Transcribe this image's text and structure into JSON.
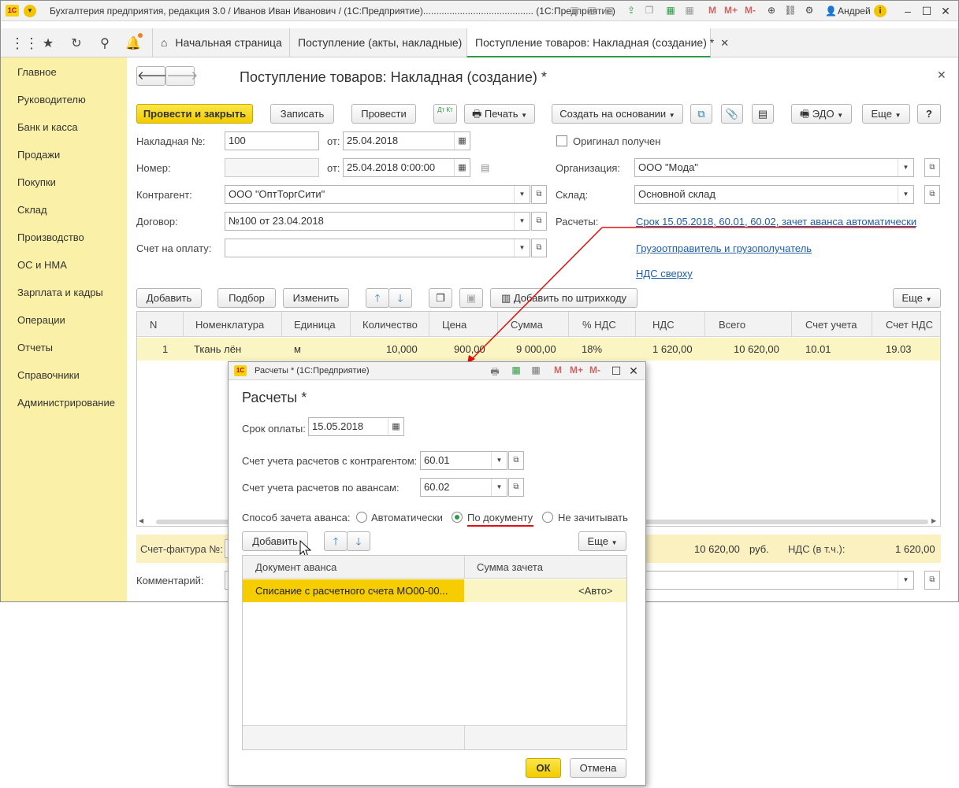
{
  "window": {
    "title": "Бухгалтерия предприятия, редакция 3.0 / Иванов Иван Иванович / (1С:Предприятие).......................................... (1С:Предприятие)",
    "user": "Андрей"
  },
  "tabs": [
    {
      "label": "Начальная страница"
    },
    {
      "label": "Поступление (акты, накладные)"
    },
    {
      "label": "Поступление товаров: Накладная (создание) *"
    }
  ],
  "sidebar": {
    "items": [
      "Главное",
      "Руководителю",
      "Банк и касса",
      "Продажи",
      "Покупки",
      "Склад",
      "Производство",
      "ОС и НМА",
      "Зарплата и кадры",
      "Операции",
      "Отчеты",
      "Справочники",
      "Администрирование"
    ]
  },
  "doc": {
    "title": "Поступление товаров: Накладная (создание) *",
    "toolbar": {
      "post_close": "Провести и закрыть",
      "save": "Записать",
      "post": "Провести",
      "dtkt": "Дт Кт",
      "print": "Печать",
      "create_based": "Создать на основании",
      "edo": "ЭДО",
      "more": "Еще",
      "help": "?"
    },
    "invoice_no_label": "Накладная №:",
    "invoice_no": "100",
    "from_label": "от:",
    "date1": "25.04.2018",
    "original_label": "Оригинал получен",
    "number_label": "Номер:",
    "number": "",
    "date2": "25.04.2018  0:00:00",
    "org_label": "Организация:",
    "org": "ООО \"Мода\"",
    "counterparty_label": "Контрагент:",
    "counterparty": "ООО \"ОптТоргСити\"",
    "warehouse_label": "Склад:",
    "warehouse": "Основной склад",
    "contract_label": "Договор:",
    "contract": "№100 от 23.04.2018",
    "settlements_label": "Расчеты:",
    "settlements_link": "Срок 15.05.2018, 60.01, 60.02, зачет аванса автоматически",
    "payment_invoice_label": "Счет на оплату:",
    "payment_invoice": "",
    "shipper_link": "Грузоотправитель и грузополучатель",
    "vat_link": "НДС сверху",
    "table_toolbar": {
      "add": "Добавить",
      "select": "Подбор",
      "change": "Изменить",
      "barcode": "Добавить по штрихкоду",
      "more": "Еще"
    },
    "columns": [
      "N",
      "Номенклатура",
      "Единица",
      "Количество",
      "Цена",
      "Сумма",
      "% НДС",
      "НДС",
      "Всего",
      "Счет учета",
      "Счет НДС"
    ],
    "rows": [
      [
        "1",
        "Ткань лён",
        "м",
        "10,000",
        "900,00",
        "9 000,00",
        "18%",
        "1 620,00",
        "10 620,00",
        "10.01",
        "19.03"
      ]
    ],
    "sf_label": "Счет-фактура №:",
    "total": "10 620,00",
    "currency": "руб.",
    "vat_incl_label": "НДС (в т.ч.):",
    "vat_total": "1 620,00",
    "comment_label": "Комментарий:"
  },
  "dialog": {
    "window_title": "Расчеты * (1С:Предприятие)",
    "heading": "Расчеты *",
    "due_label": "Срок оплаты:",
    "due": "15.05.2018",
    "acct_cp_label": "Счет учета расчетов с контрагентом:",
    "acct_cp": "60.01",
    "acct_adv_label": "Счет учета расчетов по авансам:",
    "acct_adv": "60.02",
    "offset_label": "Способ зачета аванса:",
    "opt_auto": "Автоматически",
    "opt_doc": "По документу",
    "opt_none": "Не зачитывать",
    "add": "Добавить",
    "more": "Еще",
    "columns": [
      "Документ аванса",
      "Сумма зачета"
    ],
    "rows": [
      [
        "Списание с расчетного счета МО00-00...",
        "<Авто>"
      ]
    ],
    "ok": "ОК",
    "cancel": "Отмена"
  },
  "colors": {
    "accent_yellow": "#f5d30f",
    "sidebar": "#fbf0a7",
    "link": "#1f5fa8",
    "annotation_red": "#e01010",
    "row_highlight": "#fbf4c3"
  }
}
